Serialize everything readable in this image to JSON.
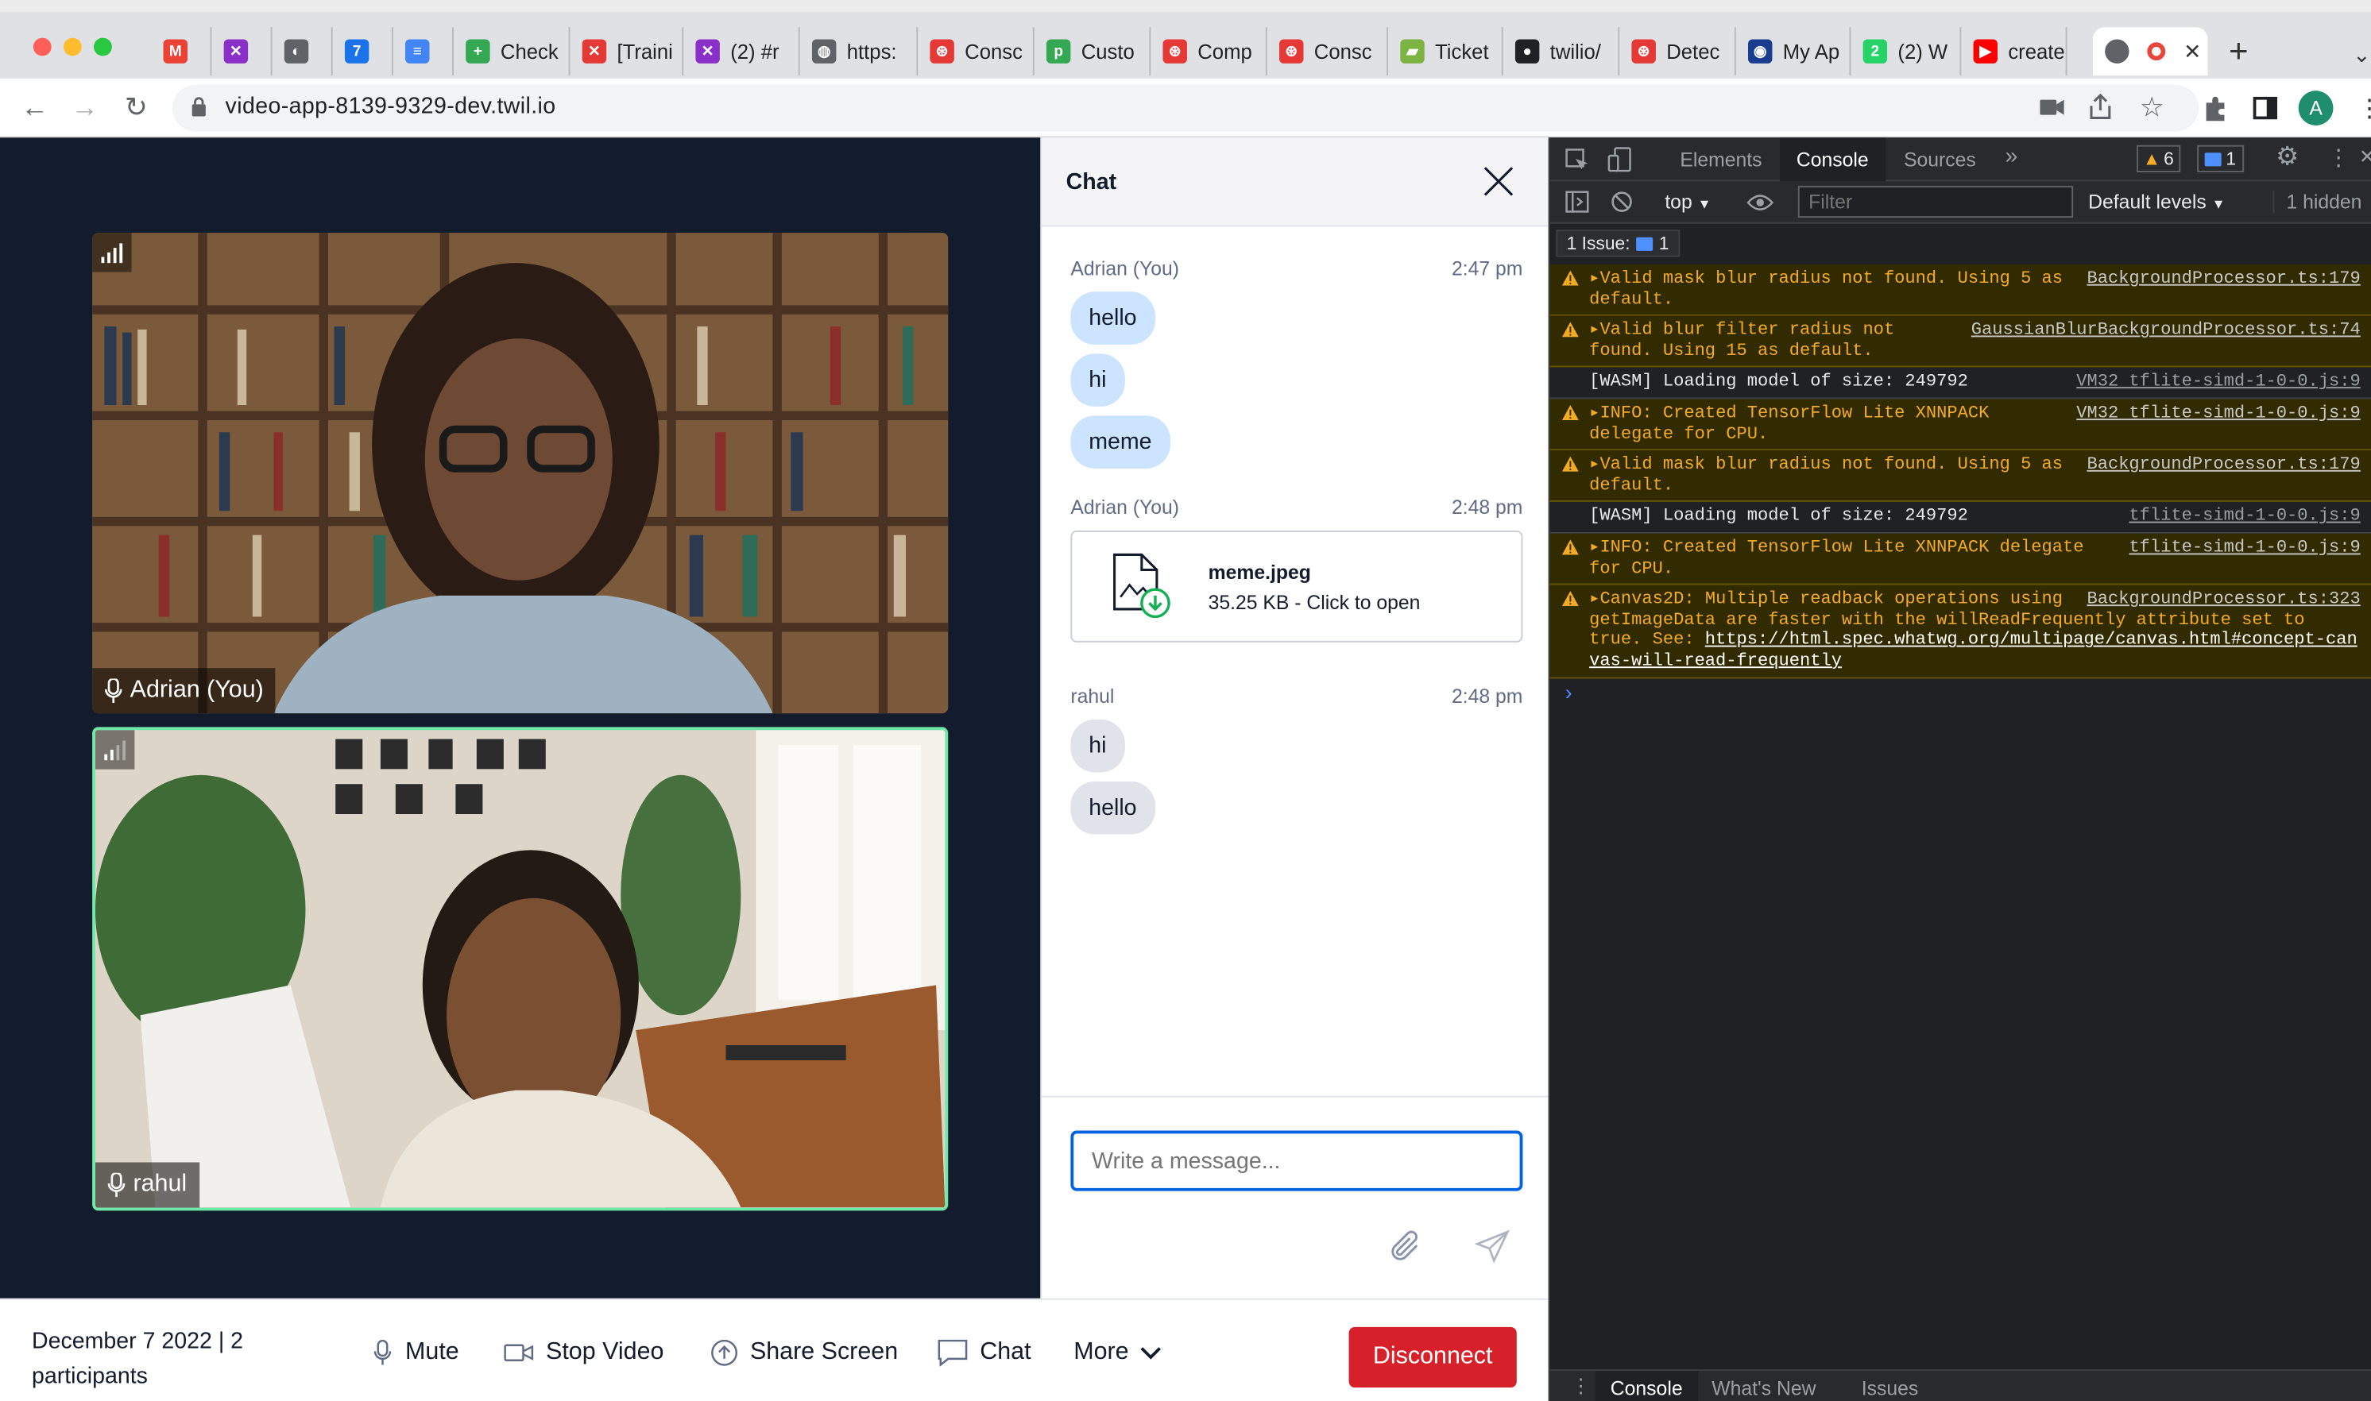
{
  "browser": {
    "tabs": [
      {
        "label": "",
        "color": "#ea4335",
        "glyph": "M"
      },
      {
        "label": "",
        "color": "#8b2fc9",
        "glyph": "✕"
      },
      {
        "label": "",
        "color": "#5f6368",
        "glyph": "◐"
      },
      {
        "label": "",
        "color": "#1a73e8",
        "glyph": "7"
      },
      {
        "label": "",
        "color": "#4285f4",
        "glyph": "≡"
      },
      {
        "label": "Check",
        "color": "#34a853",
        "glyph": "+"
      },
      {
        "label": "[Traini",
        "color": "#e53935",
        "glyph": "✕"
      },
      {
        "label": "(2) #r",
        "color": "#8b2fc9",
        "glyph": "✕"
      },
      {
        "label": "https:",
        "color": "#5f6368",
        "glyph": "◍"
      },
      {
        "label": "Consc",
        "color": "#e53935",
        "glyph": "⊛"
      },
      {
        "label": "Custo",
        "color": "#34a853",
        "glyph": "p"
      },
      {
        "label": "Comp",
        "color": "#e53935",
        "glyph": "⊛"
      },
      {
        "label": "Consc",
        "color": "#e53935",
        "glyph": "⊛"
      },
      {
        "label": "Ticket",
        "color": "#7cb342",
        "glyph": "▰"
      },
      {
        "label": "twilio/",
        "color": "#202124",
        "glyph": "●"
      },
      {
        "label": "Detec",
        "color": "#e53935",
        "glyph": "⊛"
      },
      {
        "label": "My Ap",
        "color": "#1a3d8f",
        "glyph": "◉"
      },
      {
        "label": "(2) W",
        "color": "#25d366",
        "glyph": "2"
      },
      {
        "label": "create",
        "color": "#ff0000",
        "glyph": "▶"
      }
    ],
    "url": "video-app-8139-9329-dev.twil.io",
    "profile_initial": "A"
  },
  "video": {
    "participants": [
      {
        "name": "Adrian (You)"
      },
      {
        "name": "rahul"
      }
    ]
  },
  "chat": {
    "title": "Chat",
    "groups": [
      {
        "author": "Adrian (You)",
        "time": "2:47 pm",
        "messages": [
          "hello",
          "hi",
          "meme"
        ]
      },
      {
        "author": "Adrian (You)",
        "time": "2:48 pm",
        "file": {
          "name": "meme.jpeg",
          "info": "35.25 KB - Click to open"
        }
      },
      {
        "author": "rahul",
        "time": "2:48 pm",
        "messages": [
          "hi",
          "hello"
        ]
      }
    ],
    "placeholder": "Write a message..."
  },
  "bottom_bar": {
    "date_line1": "December 7 2022 | 2",
    "date_line2": "participants",
    "mute": "Mute",
    "stop_video": "Stop Video",
    "share_screen": "Share Screen",
    "chat": "Chat",
    "more": "More",
    "disconnect": "Disconnect"
  },
  "devtools": {
    "tabs": [
      "Elements",
      "Console",
      "Sources"
    ],
    "warnings_count": "6",
    "issues_count": "1",
    "context": "top",
    "filter_placeholder": "Filter",
    "levels": "Default levels",
    "hidden": "1 hidden",
    "issue_badge": "1 Issue:",
    "issue_badge_count": "1",
    "logs": [
      {
        "level": "warn",
        "text": "▸Valid mask blur radius not found. Using 5 as default.",
        "source": "BackgroundProcessor.ts:179"
      },
      {
        "level": "warn",
        "text": "▸Valid blur filter radius not found. Using 15 as default.",
        "source": "GaussianBlurBackgroundProcessor.ts:74"
      },
      {
        "level": "info",
        "text": "[WASM] Loading model of size: 249792",
        "source": "VM32 tflite-simd-1-0-0.js:9"
      },
      {
        "level": "warn",
        "text": "▸INFO: Created TensorFlow Lite XNNPACK delegate for CPU.",
        "source": "VM32 tflite-simd-1-0-0.js:9"
      },
      {
        "level": "warn",
        "text": "▸Valid mask blur radius not found. Using 5 as default.",
        "source": "BackgroundProcessor.ts:179"
      },
      {
        "level": "info",
        "text": "[WASM] Loading model of size: 249792",
        "source": "tflite-simd-1-0-0.js:9"
      },
      {
        "level": "warn",
        "text": "▸INFO: Created TensorFlow Lite XNNPACK delegate for CPU.",
        "source": "tflite-simd-1-0-0.js:9"
      },
      {
        "level": "warn",
        "text": "▸Canvas2D: Multiple readback operations using getImageData are faster with the willReadFrequently attribute set to true. See: ",
        "source": "BackgroundProcessor.ts:323",
        "link": "https://html.spec.whatwg.org/multipage/canvas.html#concept-canvas-will-read-frequently"
      }
    ],
    "drawer_tabs": [
      "Console",
      "What's New",
      "Issues"
    ]
  }
}
